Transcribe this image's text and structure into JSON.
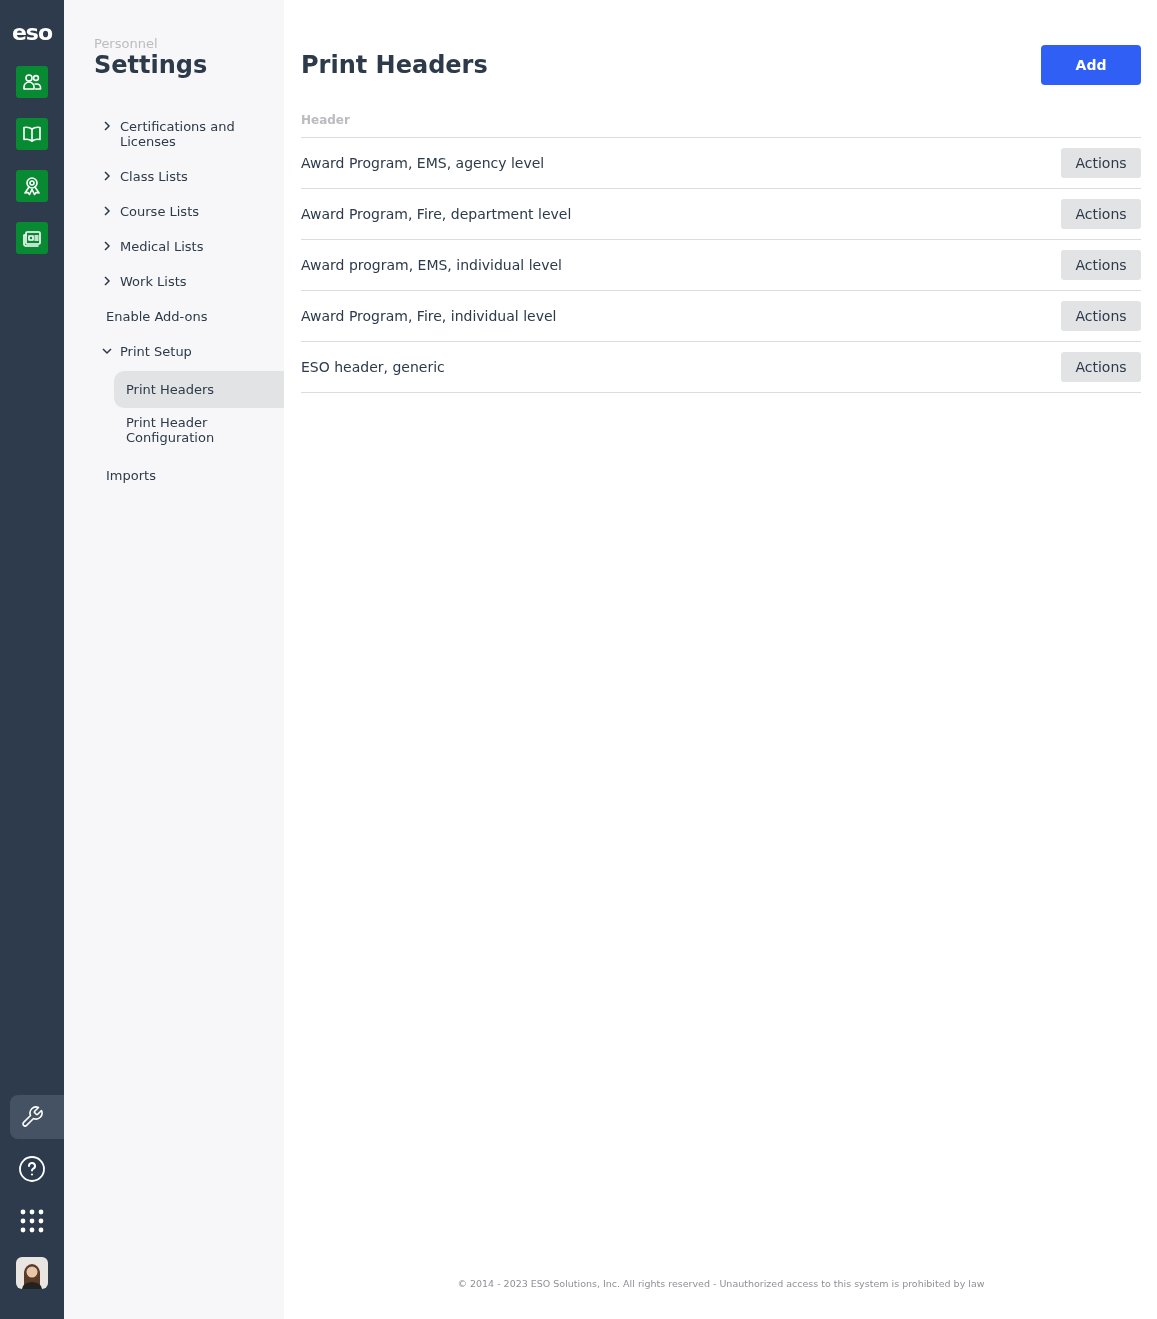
{
  "rail": {
    "logo": "eso",
    "apps": [
      {
        "kind": "people"
      },
      {
        "kind": "book"
      },
      {
        "kind": "award"
      },
      {
        "kind": "news"
      }
    ],
    "tools": [
      {
        "kind": "wrench",
        "selected": true
      },
      {
        "kind": "help",
        "selected": false
      },
      {
        "kind": "grid",
        "selected": false
      },
      {
        "kind": "avatar",
        "selected": false
      }
    ]
  },
  "sidebar": {
    "module": "Personnel",
    "title": "Settings",
    "items": [
      {
        "label": "Certifications and Licenses",
        "expanded": false
      },
      {
        "label": "Class Lists",
        "expanded": false
      },
      {
        "label": "Course Lists",
        "expanded": false
      },
      {
        "label": "Medical Lists",
        "expanded": false
      },
      {
        "label": "Work Lists",
        "expanded": false
      },
      {
        "label": "Enable Add-ons"
      },
      {
        "label": "Print Setup",
        "expanded": true,
        "children": [
          {
            "label": "Print Headers",
            "selected": true
          },
          {
            "label": "Print Header Configuration",
            "selected": false
          }
        ]
      },
      {
        "label": "Imports"
      }
    ]
  },
  "page": {
    "title": "Print Headers",
    "add_button": "Add"
  },
  "table": {
    "columns": [
      "Header"
    ],
    "rows": [
      {
        "header": "Award Program, EMS, agency level",
        "action": "Actions"
      },
      {
        "header": "Award Program, Fire, department level",
        "action": "Actions"
      },
      {
        "header": "Award program, EMS, individual level",
        "action": "Actions"
      },
      {
        "header": "Award Program, Fire, individual level",
        "action": "Actions"
      },
      {
        "header": "ESO header, generic",
        "action": "Actions"
      }
    ]
  },
  "footer": "© 2014 - 2023 ESO Solutions, Inc. All rights reserved - Unauthorized access to this system is prohibited by law"
}
